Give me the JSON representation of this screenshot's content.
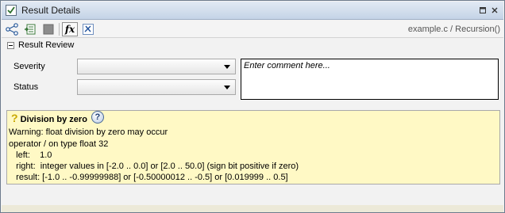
{
  "window": {
    "title": "Result Details"
  },
  "toolbar": {
    "fx_label": "fx",
    "breadcrumb": "example.c / Recursion()"
  },
  "review": {
    "section_title": "Result Review",
    "severity_label": "Severity",
    "severity_value": "",
    "status_label": "Status",
    "status_value": "",
    "comment_placeholder": "Enter comment here..."
  },
  "details": {
    "title": "Division by zero",
    "help_glyph": "?",
    "lines": [
      "Warning: float division by zero may occur",
      "operator / on type float 32",
      "   left:    1.0",
      "   right:  integer values in [-2.0 .. 0.0] or [2.0 .. 50.0] (sign bit positive if zero)",
      "   result: [-1.0 .. -0.99999988] or [-0.50000012 .. -0.5] or [0.019999 .. 0.5]"
    ]
  },
  "colors": {
    "details_bg": "#fff9c5",
    "title_gradient_top": "#e2eaf4",
    "title_gradient_bottom": "#c4d3e6"
  }
}
